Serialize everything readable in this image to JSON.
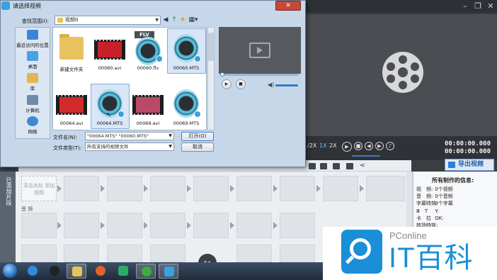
{
  "dialog": {
    "title": "请选择视频",
    "close": "✕",
    "lookin_label": "查找范围(I):",
    "lookin_value": "视频0",
    "filename_label": "文件名(N):",
    "filename_value": "\"00064.MTS\" \"00060.MTS\"",
    "filetype_label": "文件类型(T):",
    "filetype_value": "所有支持的视频文件",
    "open_button": "打开(O)",
    "cancel_button": "取消"
  },
  "places": [
    {
      "label": "最近访问的位置",
      "color": "#3a86d6"
    },
    {
      "label": "桌面",
      "color": "#4aa2e6"
    },
    {
      "label": "库",
      "color": "#e3b653"
    },
    {
      "label": "计算机",
      "color": "#6f8aa8"
    },
    {
      "label": "网络",
      "color": "#3d8ad1"
    }
  ],
  "files": [
    {
      "name": "新建文件夹",
      "kind": "folder",
      "selected": false
    },
    {
      "name": "00060.avi",
      "kind": "film",
      "color": "#c8202a",
      "selected": false
    },
    {
      "name": "00060.flv",
      "kind": "flv",
      "selected": false
    },
    {
      "name": "00060.MTS",
      "kind": "reel",
      "selected": true
    },
    {
      "name": "00064.avi",
      "kind": "film",
      "color": "#d12a2a",
      "selected": false
    },
    {
      "name": "00064.MTS",
      "kind": "reel",
      "selected": true
    },
    {
      "name": "00069.avi",
      "kind": "film",
      "color": "#b94a66",
      "selected": false
    },
    {
      "name": "00069.MTS",
      "kind": "reel",
      "selected": false
    }
  ],
  "flv_tag": "FLV",
  "player": {
    "speeds": [
      "/2X",
      "1X",
      "2X"
    ],
    "active_speed": "1X",
    "time_current": "00:00:00.000",
    "time_total": "00:00:00.000",
    "export_label": "导出视频"
  },
  "timeline": {
    "side_label": "已添加片段",
    "first_slot": "双击此处\n添加视频",
    "audio_label": "音 频"
  },
  "info": {
    "title": "所有制作的信息:",
    "rows": [
      {
        "k": "视　频:",
        "v": "0个视频"
      },
      {
        "k": "音　频:",
        "v": "0个音频"
      },
      {
        "k": "字幕特效:",
        "v": "0个字幕"
      },
      {
        "k": "Ⅲ　T",
        "v": "Y:"
      },
      {
        "k": "卡　拉",
        "v": "OK:"
      },
      {
        "k": "转场特效:",
        "v": ""
      }
    ]
  },
  "watermark": {
    "small": "PConline",
    "big": "IT百科"
  },
  "colors": {
    "accent": "#1a8fd8",
    "dialog_bg": "#c7d7ea",
    "close_red": "#c9473b"
  }
}
